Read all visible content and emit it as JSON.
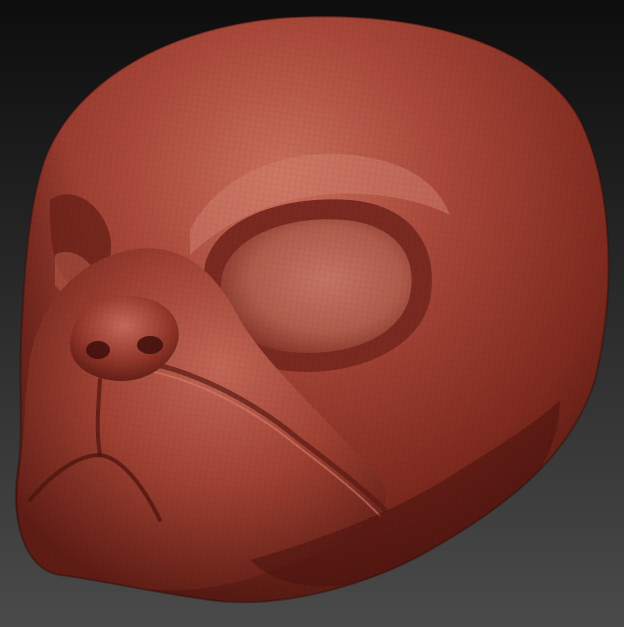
{
  "viewport": {
    "background_top": "#0e0e0e",
    "background_bottom": "#4a4a4a"
  },
  "model": {
    "subject": "sculpted-dog-head-mesh",
    "material_color": "#9a3a2c",
    "highlight_color": "#c86a5a",
    "shadow_color": "#4a1410",
    "wireframe_overlay": true
  }
}
